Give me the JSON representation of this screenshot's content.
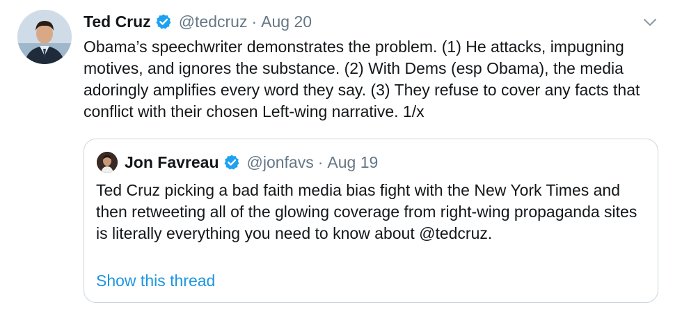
{
  "tweet": {
    "author_name": "Ted Cruz",
    "author_handle": "@tedcruz",
    "separator": "·",
    "date": "Aug 20",
    "text": "Obama’s speechwriter demonstrates the problem. (1) He attacks, impugning motives, and ignores the substance. (2) With Dems (esp Obama), the media adoringly amplifies every word they say. (3) They refuse to cover any facts that conflict with their chosen Left-wing narrative. 1/x",
    "verified_icon": "verified-badge-icon",
    "menu_icon": "chevron-down-icon"
  },
  "quoted_tweet": {
    "author_name": "Jon Favreau",
    "author_handle": "@jonfavs",
    "separator": "·",
    "date": "Aug 19",
    "text": "Ted Cruz picking a bad faith media bias fight with the New York Times and then retweeting all of the glowing coverage from right-wing propaganda sites is literally everything you need to know about @tedcruz.",
    "show_thread_label": "Show this thread"
  },
  "colors": {
    "verified_blue": "#1da1f2",
    "link_blue": "#1b95e0",
    "secondary_text": "#657786",
    "border": "#ccd6dd"
  }
}
